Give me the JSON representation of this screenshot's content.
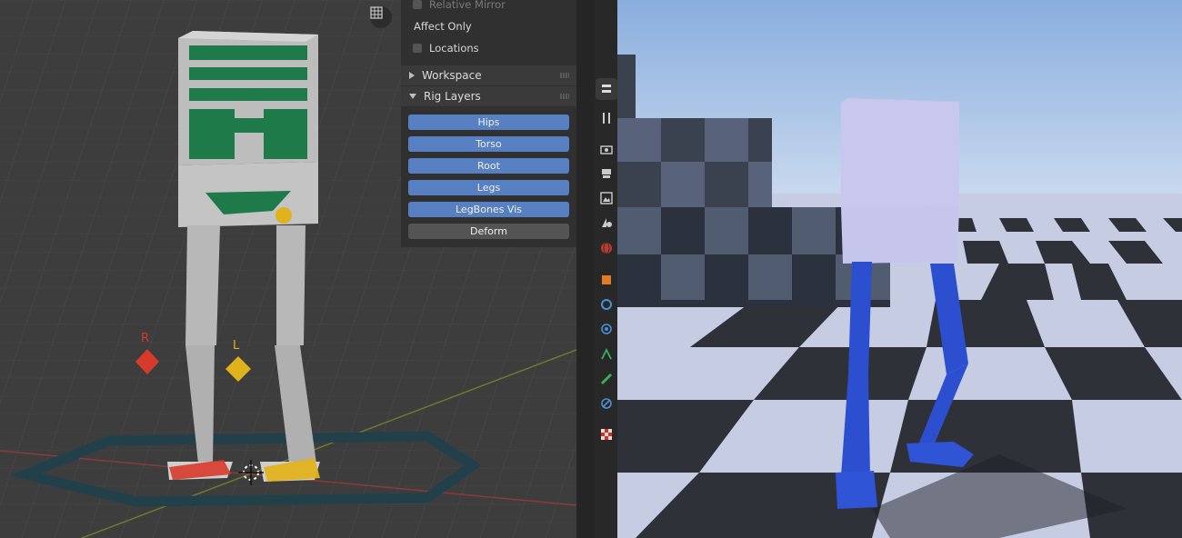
{
  "viewport3d": {
    "grid_toggle_icon": "grid-icon",
    "bone_labels": {
      "right": "R",
      "left": "L"
    },
    "colors": {
      "background": "#3d3d3d",
      "grid": "#454545",
      "x_axis": "#8a3a3a",
      "y_axis": "#6b7a2e",
      "body_green": "#1f7a4a",
      "bone_grey": "#bfbfbf",
      "ik_red": "#d63a2a",
      "ik_yellow": "#e0b21c",
      "root_ring": "#22404a"
    }
  },
  "npanel": {
    "relative_mirror_label": "Relative Mirror",
    "affect_only_label": "Affect Only",
    "locations_label": "Locations",
    "workspace_header": "Workspace",
    "rig_layers_header": "Rig Layers",
    "layers": [
      {
        "label": "Hips",
        "active": true
      },
      {
        "label": "Torso",
        "active": true
      },
      {
        "label": "Root",
        "active": true
      },
      {
        "label": "Legs",
        "active": true
      },
      {
        "label": "LegBones Vis",
        "active": true
      },
      {
        "label": "Deform",
        "active": false
      }
    ],
    "colors": {
      "panel": "#303030",
      "header": "#3a3a3a",
      "active_button": "#5680c2",
      "inactive_button": "#545454"
    }
  },
  "toolstrip": {
    "icons": [
      "tool-settings-icon",
      "render-icon",
      "output-icon",
      "view-layer-icon",
      "scene-icon",
      "world-icon",
      "object-icon",
      "modifier-icon",
      "particles-icon",
      "physics-icon",
      "constraints-icon",
      "object-data-icon",
      "texture-icon"
    ]
  },
  "game_view": {
    "colors": {
      "sky_top": "#8aaede",
      "sky_horizon": "#c9d9ee",
      "floor_light": "#c6cde2",
      "floor_dark": "#2e3138",
      "cube_body": "#c8c8ef",
      "legs": "#2c4fd0"
    }
  }
}
